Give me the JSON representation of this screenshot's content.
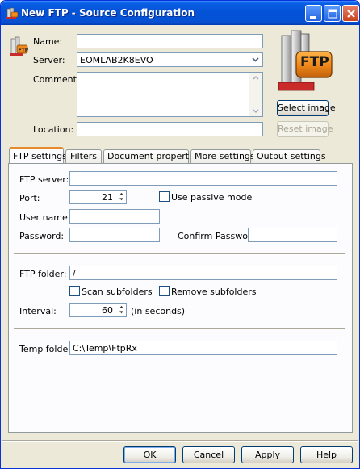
{
  "window": {
    "title": "New FTP - Source Configuration"
  },
  "header": {
    "name_label": "Name:",
    "name_value": "",
    "server_label": "Server:",
    "server_value": "EOMLAB2K8EVO",
    "comments_label": "Comments:",
    "comments_value": "",
    "location_label": "Location:",
    "location_value": "",
    "select_image_label": "Select image",
    "reset_image_label": "Reset image",
    "logo_text": "FTP"
  },
  "tabs": [
    {
      "label": "FTP settings",
      "active": true
    },
    {
      "label": "Filters",
      "active": false
    },
    {
      "label": "Document properties",
      "active": false
    },
    {
      "label": "More settings",
      "active": false
    },
    {
      "label": "Output settings",
      "active": false
    }
  ],
  "ftp": {
    "server_label": "FTP server:",
    "server_value": "",
    "port_label": "Port:",
    "port_value": "21",
    "passive_label": "Use passive mode",
    "passive_checked": false,
    "username_label": "User name:",
    "username_value": "",
    "password_label": "Password:",
    "password_value": "",
    "confirm_label": "Confirm Password:",
    "confirm_value": "",
    "folder_label": "FTP folder:",
    "folder_value": "/",
    "scan_label": "Scan subfolders",
    "scan_checked": false,
    "remove_label": "Remove subfolders",
    "remove_checked": false,
    "interval_label": "Interval:",
    "interval_value": "60",
    "interval_unit": "(in seconds)",
    "temp_label": "Temp folder:",
    "temp_value": "C:\\Temp\\FtpRx"
  },
  "footer": {
    "ok_label": "OK",
    "cancel_label": "Cancel",
    "apply_label": "Apply",
    "help_label": "Help"
  },
  "colors": {
    "titlebar": "#0453d6",
    "face": "#ece9d8",
    "field_border": "#7f9db9",
    "tab_accent": "#e68b2c",
    "logo_orange": "#f08a1c"
  }
}
